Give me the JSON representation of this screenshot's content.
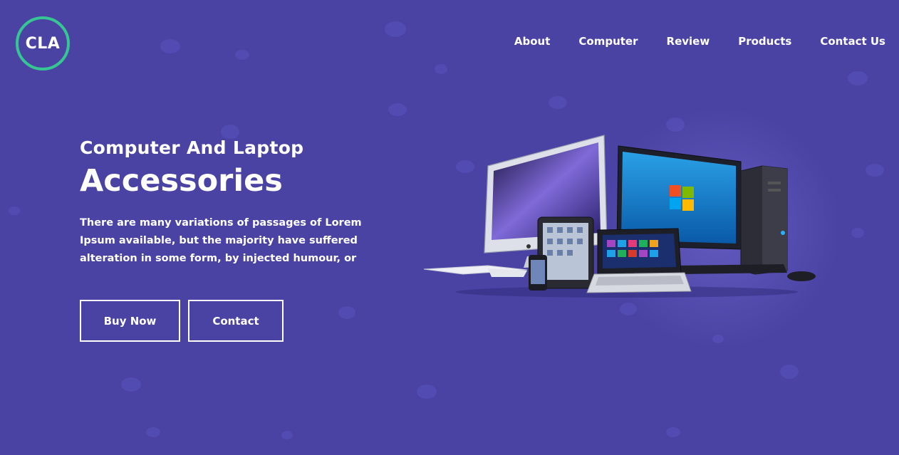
{
  "brand": {
    "logo_text": "CLA",
    "accent": "#35c693",
    "background": "#4a43a4"
  },
  "nav": {
    "items": [
      {
        "label": "About"
      },
      {
        "label": "Computer"
      },
      {
        "label": "Review"
      },
      {
        "label": "Products"
      },
      {
        "label": "Contact Us"
      }
    ]
  },
  "hero": {
    "subtitle": "Computer And Laptop",
    "title": "Accessories",
    "description": "There are many variations of passages of Lorem Ipsum available, but the majority have suffered alteration in some form, by injected humour, or",
    "buy_label": "Buy Now",
    "contact_label": "Contact"
  },
  "image": {
    "icons": [
      "imac-icon",
      "monitor-icon",
      "tower-pc-icon",
      "tablet-icon",
      "phone-icon",
      "laptop-icon",
      "keyboard-icon",
      "mouse-icon"
    ]
  }
}
